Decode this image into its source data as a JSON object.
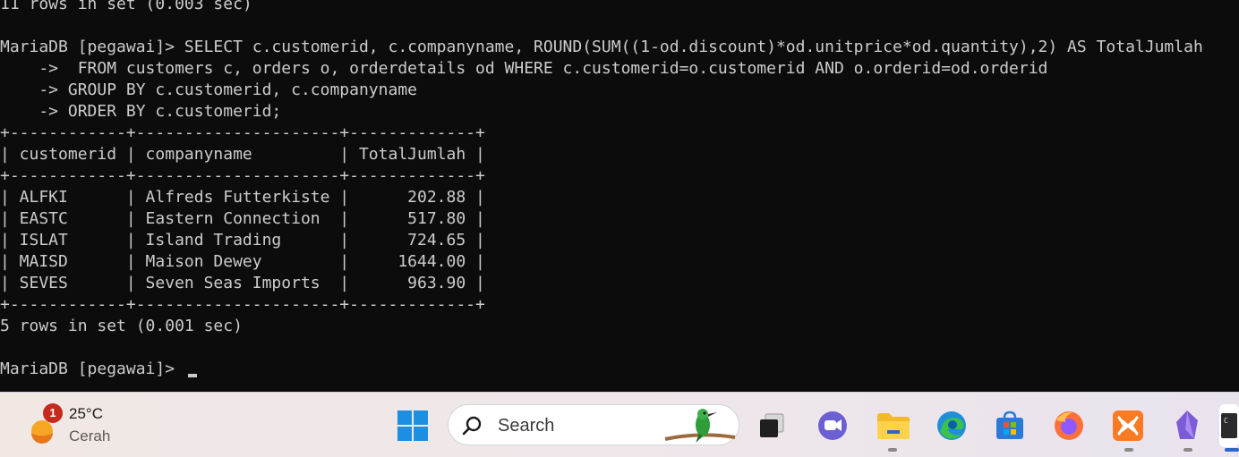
{
  "terminal": {
    "lines": [
      "11 rows in set (0.003 sec)",
      "",
      "MariaDB [pegawai]> SELECT c.customerid, c.companyname, ROUND(SUM((1-od.discount)*od.unitprice*od.quantity),2) AS TotalJumlah",
      "    ->  FROM customers c, orders o, orderdetails od WHERE c.customerid=o.customerid AND o.orderid=od.orderid",
      "    -> GROUP BY c.customerid, c.companyname",
      "    -> ORDER BY c.customerid;",
      "+------------+---------------------+-------------+",
      "| customerid | companyname         | TotalJumlah |",
      "+------------+---------------------+-------------+",
      "| ALFKI      | Alfreds Futterkiste |      202.88 |",
      "| EASTC      | Eastern Connection  |      517.80 |",
      "| ISLAT      | Island Trading      |      724.65 |",
      "| MAISD      | Maison Dewey        |     1644.00 |",
      "| SEVES      | Seven Seas Imports  |      963.90 |",
      "+------------+---------------------+-------------+",
      "5 rows in set (0.001 sec)",
      "",
      "MariaDB [pegawai]> "
    ]
  },
  "taskbar": {
    "weather": {
      "badge": "1",
      "temp": "25°C",
      "condition": "Cerah",
      "icon": "sun-cloud-icon"
    },
    "search": {
      "placeholder": "Search"
    },
    "apps": [
      {
        "name": "start",
        "icon": "windows-logo-icon"
      },
      {
        "name": "task-view",
        "icon": "task-view-icon"
      },
      {
        "name": "teams-chat",
        "icon": "chat-icon"
      },
      {
        "name": "file-explorer",
        "icon": "folder-icon"
      },
      {
        "name": "edge",
        "icon": "edge-icon"
      },
      {
        "name": "microsoft-store",
        "icon": "store-icon"
      },
      {
        "name": "firefox",
        "icon": "firefox-icon"
      },
      {
        "name": "xampp",
        "icon": "xampp-icon"
      },
      {
        "name": "obsidian",
        "icon": "obsidian-icon"
      },
      {
        "name": "terminal",
        "icon": "terminal-icon"
      }
    ],
    "colors": {
      "accent": "#2d66c9",
      "badge": "#c42b1c",
      "terminal_bg": "#0c0c0c",
      "terminal_fg": "#cccccc"
    }
  }
}
